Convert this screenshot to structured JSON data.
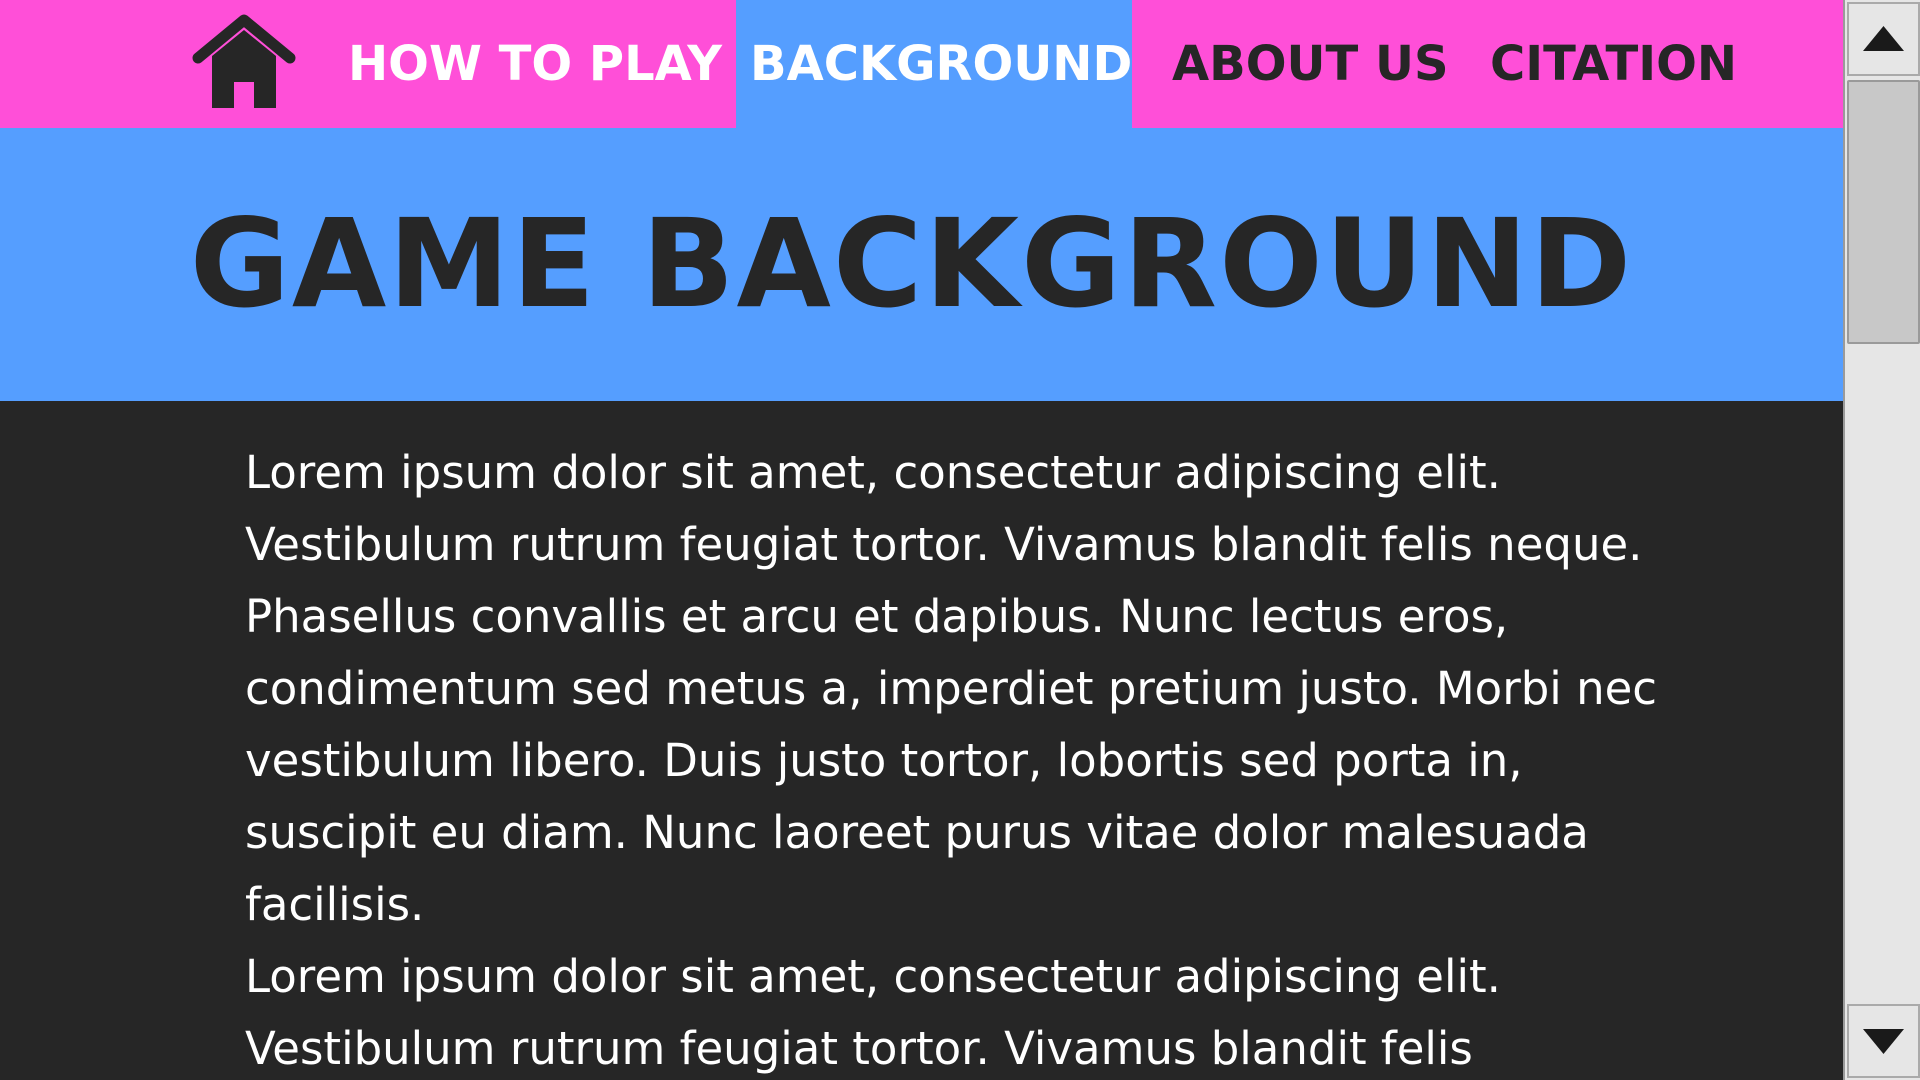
{
  "nav": {
    "home_icon": "house-icon",
    "items": [
      {
        "label": "HOW TO PLAY"
      },
      {
        "label": "BACKGROUND",
        "active": true
      },
      {
        "label": "ABOUT US"
      },
      {
        "label": "CITATION"
      }
    ]
  },
  "hero": {
    "title": "GAME BACKGROUND"
  },
  "content": {
    "paragraphs": [
      "Lorem ipsum dolor sit amet, consectetur adipiscing elit. Vestibulum rutrum feugiat tortor. Vivamus blandit felis neque. Phasellus convallis et arcu et dapibus. Nunc lectus eros, condimentum sed metus a, imperdiet pretium justo. Morbi nec vestibulum libero. Duis justo tortor, lobortis sed porta in, suscipit eu diam. Nunc laoreet purus vitae dolor malesuada facilisis.",
      "Lorem ipsum dolor sit amet, consectetur adipiscing elit. Vestibulum rutrum feugiat tortor. Vivamus blandit felis"
    ]
  },
  "scrollbar": {
    "up_icon": "triangle-up-icon",
    "down_icon": "triangle-down-icon"
  },
  "colors": {
    "nav_bg": "#ff4fd8",
    "accent_blue": "#559eff",
    "dark_bg": "#262626",
    "text_light": "#ffffff",
    "text_dark": "#262626"
  }
}
